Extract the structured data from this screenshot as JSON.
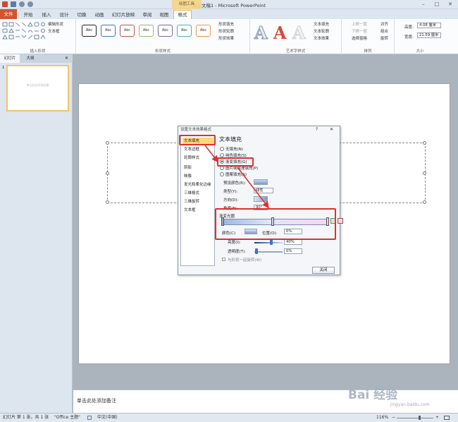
{
  "window": {
    "title": "演示文稿1 - Microsoft PowerPoint",
    "min": "–",
    "max": "□",
    "close": "✕"
  },
  "context_tab": "绘图工具",
  "tabs": [
    "文件",
    "开始",
    "插入",
    "设计",
    "切换",
    "动画",
    "幻灯片放映",
    "审阅",
    "视图",
    "格式"
  ],
  "ribbon": {
    "insert_shapes": {
      "label": "插入形状",
      "edit_shape": "编辑形状",
      "text_box": "文本框"
    },
    "shape_styles": {
      "label": "形状样式",
      "samples": [
        "Abc",
        "Abc",
        "Abc",
        "Abc",
        "Abc",
        "Abc",
        "Abc"
      ],
      "sample_colors": [
        "#222222",
        "#4472c4",
        "#c0504d",
        "#9bbb59",
        "#8064a2",
        "#4bacc6",
        "#f79646"
      ],
      "fill": "形状填充",
      "outline": "形状轮廓",
      "effects": "形状效果"
    },
    "wordart": {
      "label": "艺术字样式",
      "text_fill": "文本填充",
      "text_outline": "文本轮廓",
      "text_effects": "文本效果"
    },
    "arrange": {
      "label": "排列",
      "bring_forward": "上移一层",
      "send_backward": "下移一层",
      "selection_pane": "选择窗格",
      "align": "对齐",
      "group": "组合",
      "rotate": "旋转"
    },
    "size": {
      "label": "大小",
      "height_label": "高度:",
      "height_value": "4.08 厘米",
      "width_label": "宽度:",
      "width_value": "21.59 厘米"
    }
  },
  "left_pane": {
    "tab_slides": "幻灯片",
    "tab_outline": "大纲",
    "close": "✕",
    "slide_number": "1",
    "thumb_text": "单击此处添加标题"
  },
  "notes_placeholder": "单击此处添加备注",
  "status": {
    "slide_info": "幻灯片 第 1 张，共 1 张",
    "theme": "\"Office 主题\"",
    "language": "中文(中国)",
    "zoom": "116%",
    "zoom_minus": "−",
    "zoom_plus": "+"
  },
  "dialog": {
    "title": "设置文本效果格式",
    "help": "?",
    "close_x": "✕",
    "categories": [
      "文本填充",
      "文本边框",
      "轮廓样式",
      "阴影",
      "映像",
      "发光和柔化边缘",
      "三维格式",
      "三维旋转",
      "文本框"
    ],
    "section_title": "文本填充",
    "options": [
      "无填充(N)",
      "纯色填充(S)",
      "渐变填充(G)",
      "图片或纹理填充(P)",
      "图案填充(A)"
    ],
    "preset_colors_label": "预设颜色(R):",
    "type_label": "类型(Y):",
    "type_value": "线性",
    "direction_label": "方向(D):",
    "angle_label": "角度(E):",
    "angle_value": "90°",
    "stops_label": "渐变光圈",
    "color_label": "颜色(C)",
    "position_label": "位置(O):",
    "position_value": "0%",
    "brightness_label": "亮度(I):",
    "brightness_value": "40%",
    "transparency_label": "透明度(T):",
    "transparency_value": "0%",
    "rotate_with_shape": "与形状一起旋转(W)",
    "close_button": "关闭"
  },
  "watermark": {
    "brand": "Bai 经验",
    "url": "jingyan.baidu.com"
  }
}
